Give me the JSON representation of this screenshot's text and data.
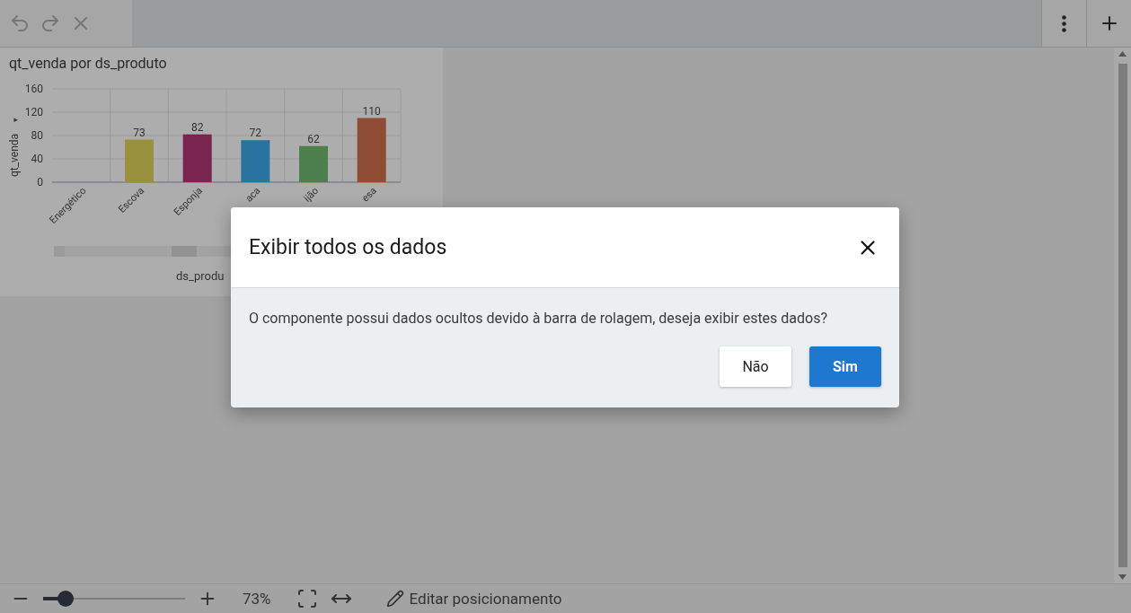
{
  "toolbar": {
    "left_buttons": [
      {
        "kind": "undo"
      },
      {
        "kind": "redo"
      },
      {
        "kind": "close"
      }
    ],
    "right_buttons": [
      {
        "kind": "more"
      },
      {
        "kind": "add"
      }
    ]
  },
  "chart_card": {
    "title": "qt_venda por ds_produto",
    "y_axis_caret": "▾",
    "chart_data": {
      "type": "bar",
      "xlabel": "ds_produ",
      "ylabel": "qt_venda",
      "categories": [
        "Energético",
        "Escova",
        "Esponja",
        "aca",
        "ijão",
        "esa"
      ],
      "values": [
        null,
        73,
        82,
        72,
        62,
        110
      ],
      "ylim": [
        0,
        160
      ],
      "yticks": [
        0,
        40,
        80,
        120,
        160
      ],
      "grid": true,
      "data_labels": true
    }
  },
  "dialog": {
    "title": "Exibir todos os dados",
    "message": "O componente possui dados ocultos devido à barra de rolagem, deseja exibir estes dados?",
    "buttons": [
      {
        "label": "Não",
        "kind": "secondary"
      },
      {
        "label": "Sim",
        "kind": "primary"
      }
    ]
  },
  "bottom_bar": {
    "zoom_slider": {
      "level": 0.16
    },
    "zoom_text": "73%",
    "edit_label": "Editar posicionamento"
  }
}
